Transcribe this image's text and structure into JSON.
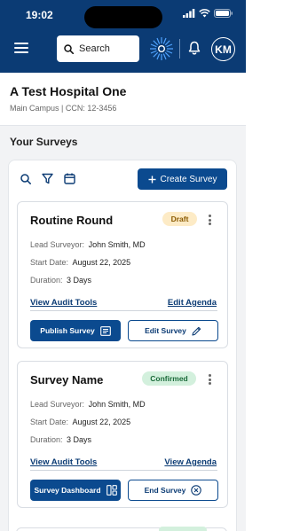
{
  "status_bar": {
    "time": "19:02"
  },
  "header": {
    "search_placeholder": "Search",
    "avatar_initials": "KM"
  },
  "hospital": {
    "name": "A Test Hospital One",
    "subtitle": "Main Campus | CCN: 12-3456"
  },
  "surveys": {
    "section_title": "Your Surveys",
    "create_label": "Create Survey",
    "cards": [
      {
        "title": "Routine Round",
        "status": "Draft",
        "lead_label": "Lead Surveyor:",
        "lead_value": "John Smith, MD",
        "start_label": "Start Date:",
        "start_value": "August 22, 2025",
        "duration_label": "Duration:",
        "duration_value": "3 Days",
        "link_left": "View Audit Tools",
        "link_right": "Edit Agenda",
        "primary_button": "Publish Survey",
        "secondary_button": "Edit Survey"
      },
      {
        "title": "Survey Name",
        "status": "Confirmed",
        "lead_label": "Lead Surveyor:",
        "lead_value": "John Smith, MD",
        "start_label": "Start Date:",
        "start_value": "August 22, 2025",
        "duration_label": "Duration:",
        "duration_value": "3 Days",
        "link_left": "View Audit Tools",
        "link_right": "View Agenda",
        "primary_button": "Survey Dashboard",
        "secondary_button": "End Survey"
      }
    ]
  },
  "colors": {
    "brand_navy": "#0b3b74",
    "button_blue": "#0b4a8f",
    "draft_badge": "#fdebc6",
    "confirmed_badge": "#d3f0dd"
  },
  "icons": {
    "menu": "hamburger-icon",
    "search": "search-icon",
    "logo": "starburst-logo",
    "bell": "bell-icon",
    "filter": "filter-icon",
    "calendar": "calendar-icon",
    "add": "plus-icon",
    "more": "kebab-icon",
    "publish": "list-icon",
    "edit": "pencil-icon",
    "dashboard": "dashboard-icon",
    "end": "close-circle-icon"
  }
}
